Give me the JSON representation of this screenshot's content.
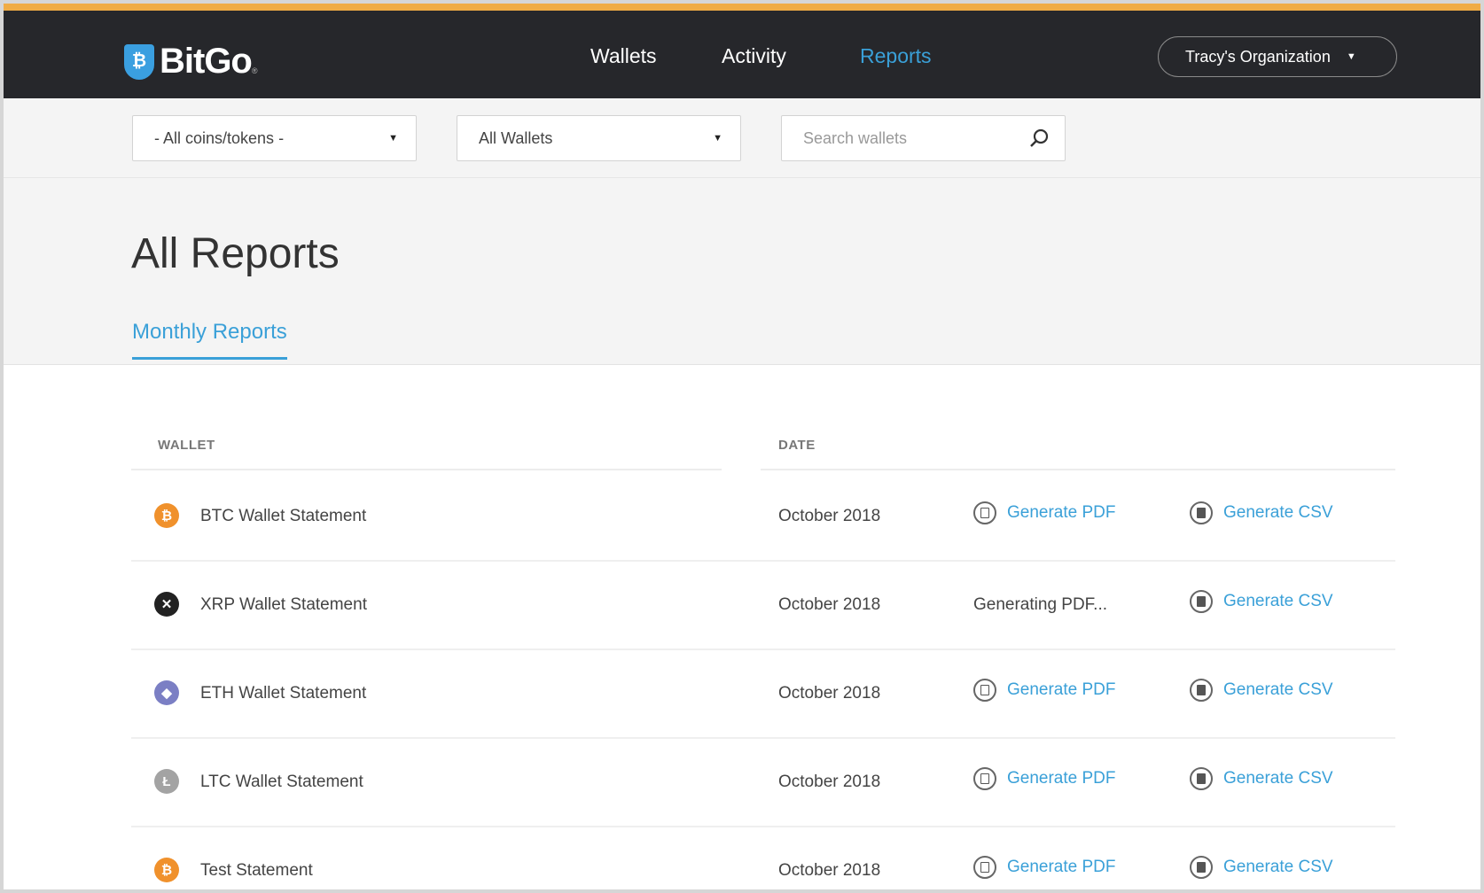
{
  "header": {
    "brand": "BitGo",
    "brand_mark": "®",
    "nav": [
      "Wallets",
      "Activity",
      "Reports"
    ],
    "active_nav": "Reports",
    "org": "Tracy's Organization"
  },
  "filters": {
    "coins": "- All coins/tokens -",
    "wallets": "All Wallets",
    "search_placeholder": "Search wallets"
  },
  "page": {
    "title": "All Reports",
    "tab": "Monthly Reports"
  },
  "table": {
    "columns": [
      "WALLET",
      "DATE"
    ],
    "rows": [
      {
        "coin": "btc",
        "icon_glyph": "₿",
        "color": "#f0912c",
        "name": "BTC Wallet Statement",
        "date": "October 2018",
        "pdf": "Generate PDF",
        "csv": "Generate CSV"
      },
      {
        "coin": "xrp",
        "icon_glyph": "✕",
        "color": "#222222",
        "name": "XRP Wallet Statement",
        "date": "October 2018",
        "pdf_status": "Generating PDF...",
        "csv": "Generate CSV"
      },
      {
        "coin": "eth",
        "icon_glyph": "◆",
        "color": "#7b7fc4",
        "name": "ETH Wallet Statement",
        "date": "October 2018",
        "pdf": "Generate PDF",
        "csv": "Generate CSV"
      },
      {
        "coin": "ltc",
        "icon_glyph": "Ł",
        "color": "#a3a3a3",
        "name": "LTC Wallet Statement",
        "date": "October 2018",
        "pdf": "Generate PDF",
        "csv": "Generate CSV"
      },
      {
        "coin": "btc",
        "icon_glyph": "₿",
        "color": "#f0912c",
        "name": "Test Statement",
        "date": "October 2018",
        "pdf": "Generate PDF",
        "csv": "Generate CSV"
      }
    ]
  },
  "colors": {
    "accent": "#3aa0d8",
    "header_bg": "#26272b",
    "top_stripe": "#f0ac45"
  }
}
